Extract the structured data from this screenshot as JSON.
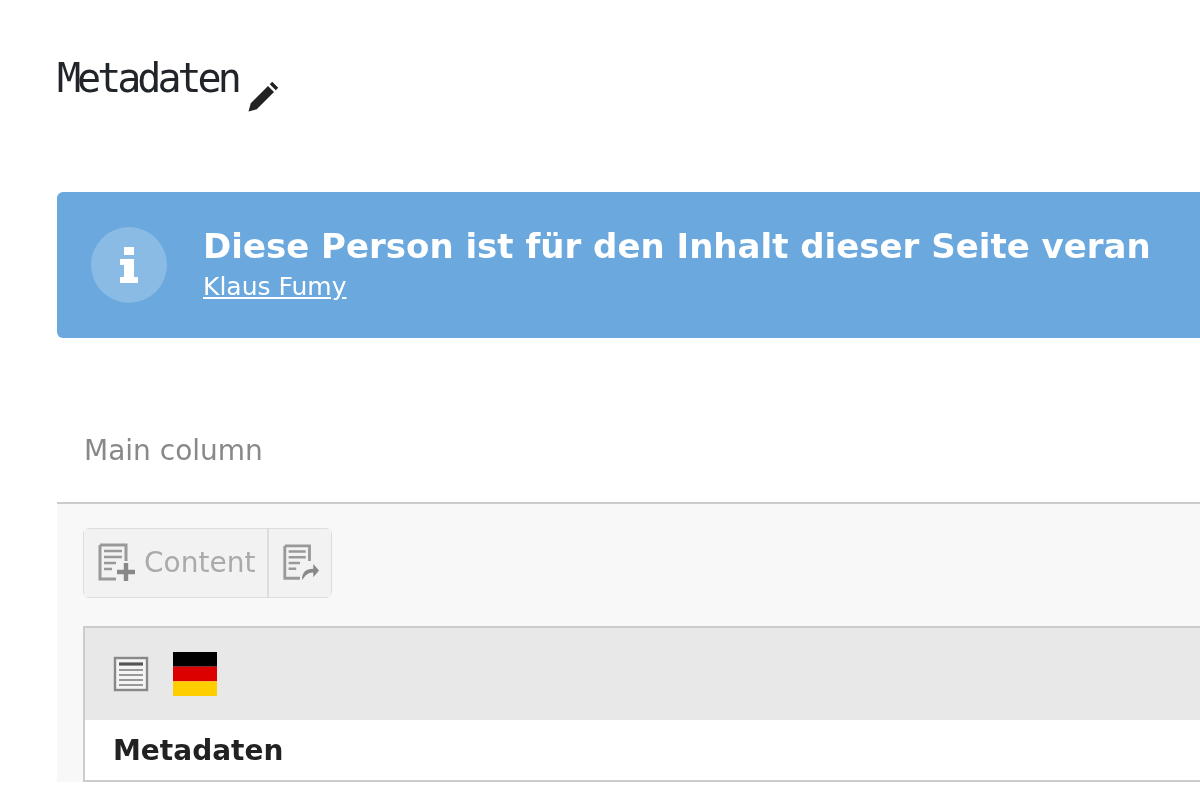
{
  "page_title": "Metadaten",
  "alert": {
    "message": "Diese Person ist für den Inhalt dieser Seite veran",
    "link": "Klaus Fumy"
  },
  "column": {
    "title": "Main column"
  },
  "toolbar": {
    "buttons": [
      {
        "kind": "new",
        "label": "Content"
      },
      {
        "kind": "paste"
      }
    ]
  },
  "content_element": {
    "header_icons": [
      {
        "kind": "text"
      },
      {
        "kind": "flag"
      }
    ],
    "heading": "Metadaten"
  }
}
